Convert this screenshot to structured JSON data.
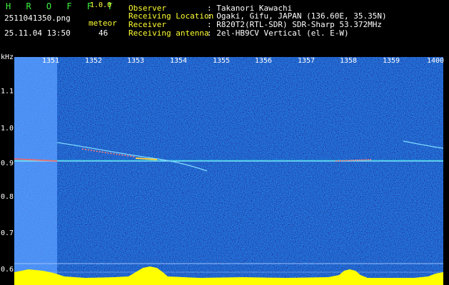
{
  "app": {
    "name": "H R O F F T",
    "version": "1.0.0"
  },
  "file": {
    "name": "2511041350.png",
    "datetime": "25.11.04 13:50"
  },
  "meteor": {
    "label": "meteor",
    "count": "46"
  },
  "info": [
    {
      "label": "Observer",
      "value": ": Takanori Kawachi"
    },
    {
      "label": "Receiving Location",
      "value": ": Ogaki, Gifu, JAPAN (136.60E, 35.35N)"
    },
    {
      "label": "Receiver",
      "value": ": R820T2(RTL-SDR) SDR-Sharp 53.372MHz"
    },
    {
      "label": "Receiving antenna",
      "value": ": 2el-HB9CV Vertical (el. E-W)"
    }
  ],
  "axis": {
    "y_unit": "kHz",
    "y_ticks": [
      "1.1",
      "1.0",
      "0.9",
      "0.8",
      "0.7",
      "0.6"
    ],
    "x_ticks": [
      "1351",
      "1352",
      "1353",
      "1354",
      "1355",
      "1356",
      "1357",
      "1358",
      "1359",
      "1400"
    ]
  },
  "colors": {
    "label_green": "#3df23d",
    "value_white": "#ffffff",
    "tick_yellow": "#ffff33",
    "background_noise": "#0a1a8c",
    "intensity_bar": "#ffff00",
    "bottom_band": "#00c8ff"
  }
}
